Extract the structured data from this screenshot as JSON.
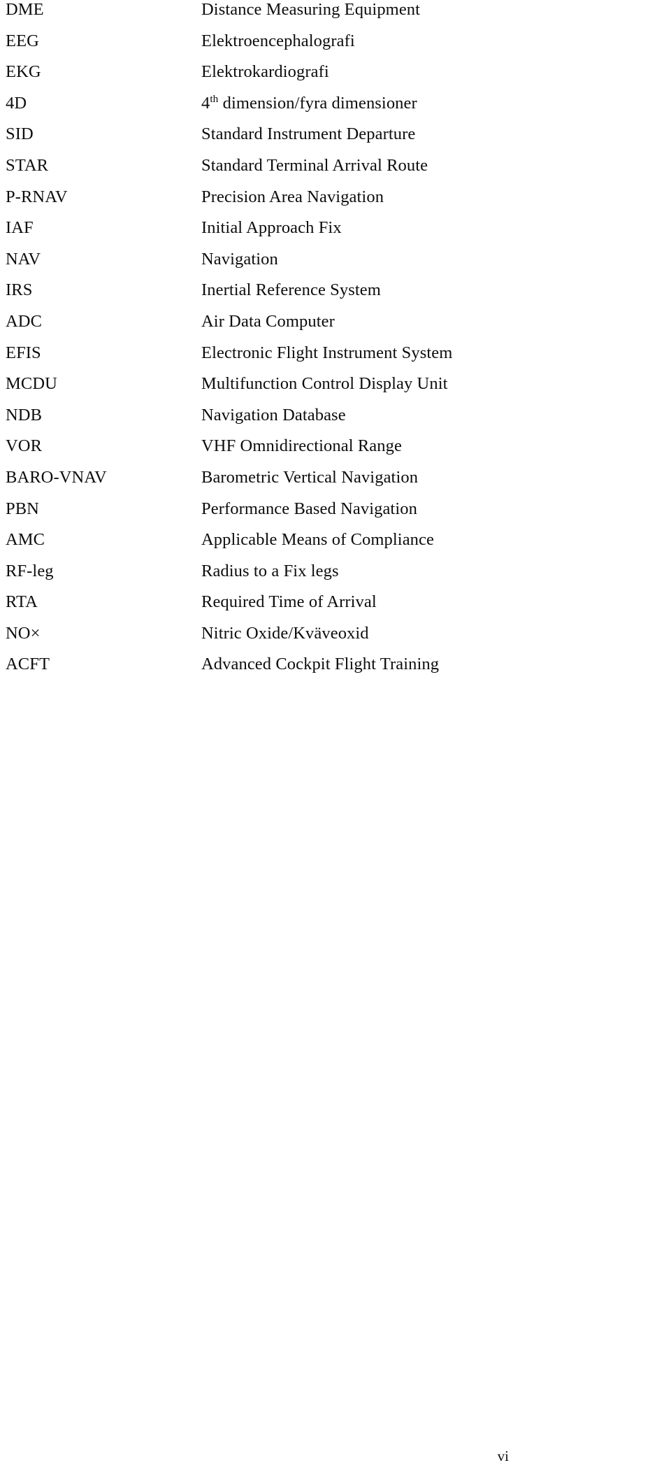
{
  "document": {
    "type": "abbreviations-list",
    "page_label": "vi"
  },
  "abbreviations": [
    {
      "term": "DME",
      "definition": "Distance Measuring Equipment"
    },
    {
      "term": "EEG",
      "definition": "Elektroencephalografi"
    },
    {
      "term": "EKG",
      "definition": "Elektrokardiografi"
    },
    {
      "term": "4D",
      "definition_pre": "4",
      "definition_sup": "th",
      "definition_post": " dimension/fyra dimensioner",
      "definition": "4th dimension/fyra dimensioner"
    },
    {
      "term": "SID",
      "definition": "Standard Instrument Departure"
    },
    {
      "term": "STAR",
      "definition": "Standard Terminal Arrival Route"
    },
    {
      "term": "P-RNAV",
      "definition": "Precision Area Navigation"
    },
    {
      "term": "IAF",
      "definition": "Initial Approach Fix"
    },
    {
      "term": "NAV",
      "definition": "Navigation"
    },
    {
      "term": "IRS",
      "definition": "Inertial Reference System"
    },
    {
      "term": "ADC",
      "definition": "Air Data Computer"
    },
    {
      "term": "EFIS",
      "definition": "Electronic Flight Instrument System"
    },
    {
      "term": "MCDU",
      "definition": "Multifunction Control Display Unit"
    },
    {
      "term": "NDB",
      "definition": "Navigation Database"
    },
    {
      "term": "VOR",
      "definition": "VHF Omnidirectional Range"
    },
    {
      "term": "BARO-VNAV",
      "definition": "Barometric Vertical Navigation"
    },
    {
      "term": "PBN",
      "definition": "Performance Based Navigation"
    },
    {
      "term": "AMC",
      "definition": "Applicable Means of Compliance"
    },
    {
      "term": "RF-leg",
      "definition": "Radius to a Fix legs"
    },
    {
      "term": "RTA",
      "definition": "Required Time of Arrival"
    },
    {
      "term": "NO×",
      "definition": "Nitric Oxide/Kväveoxid"
    },
    {
      "term": "ACFT",
      "definition": "Advanced Cockpit Flight Training"
    }
  ]
}
